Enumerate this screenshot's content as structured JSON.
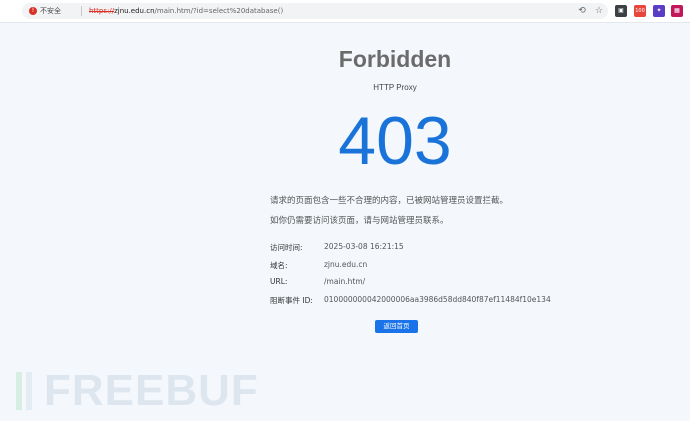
{
  "browser": {
    "security_label": "不安全",
    "url_scheme": "https://",
    "url_host": "zjnu.edu.cn",
    "url_path": "/main.htm/?id=select%20database()",
    "ext_badge": "100"
  },
  "page": {
    "title": "Forbidden",
    "subtitle": "HTTP Proxy",
    "code": "403",
    "message1": "请求的页面包含一些不合理的内容，已被网站管理员设置拦截。",
    "message2": "如你仍需要访问该页面，请与网站管理员联系。",
    "details": [
      {
        "label": "访问时间:",
        "value": "2025-03-08 16:21:15"
      },
      {
        "label": "域名:",
        "value": "zjnu.edu.cn"
      },
      {
        "label": "URL:",
        "value": "/main.htm/"
      },
      {
        "label": "阻断事件 ID:",
        "value": "010000000042000006aa3986d58dd840f87ef11484f10e134"
      }
    ],
    "back_button": "返回首页"
  },
  "watermark": {
    "text": "FREEBUF"
  },
  "colors": {
    "accent": "#1a73d9",
    "title": "#6b6b6b",
    "background": "#f4f8fd"
  }
}
